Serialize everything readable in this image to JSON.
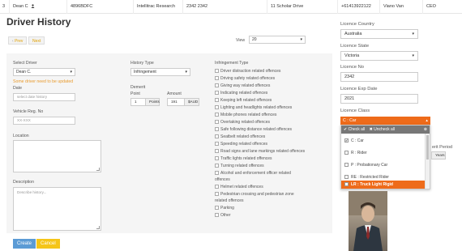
{
  "table_row": {
    "cells": [
      "3",
      "Dean C",
      "4896BDFC",
      "Intellitrac Research",
      "2342 2342",
      "11 Scholar Drive",
      "+61413922122",
      "Viano Van",
      "CEO"
    ]
  },
  "page": {
    "title": "Driver History",
    "prev_label": "Prev",
    "next_label": "Next",
    "view_label": "View",
    "view_value": "20"
  },
  "form": {
    "select_driver_label": "Select Driver",
    "select_driver_value": "Dean C.",
    "warning": "Some driver need to be updated",
    "date_label": "Date",
    "date_placeholder": "select date history",
    "vehicle_label": "Vehicle Reg. No",
    "vehicle_placeholder": "XX-XXX",
    "location_label": "Location",
    "description_label": "Description",
    "description_placeholder": "Describe history...",
    "history_type_label": "History Type",
    "history_type_value": "Infringement",
    "demerit_label": "Demerit",
    "point_label": "Point",
    "point_value": "1",
    "point_unit": "Points",
    "amount_label": "Amount",
    "amount_value": "191",
    "amount_unit": "$AUD",
    "infringement_label": "Infringement Type",
    "infringement_types": [
      "Driver distraction related offences",
      "Driving safety related offences",
      "Giving way related offences",
      "Indicating related offences",
      "Keeping left related offences",
      "Lighting and headlights related offences",
      "Mobile phones related offences",
      "Overtaking related offences",
      "Safe following distance related offences",
      "Seatbelt related offences",
      "Speeding related offences",
      "Road signs and lane markings related offences",
      "Traffic lights related offences",
      "Turning related offences",
      "Alcohol and enforcement officer related",
      "offences",
      "Helmet related offences",
      "Pedestrian crossing and pedestrian zone",
      "related offences",
      "Parking",
      "Other"
    ],
    "create_label": "Create",
    "cancel_label": "Cancel"
  },
  "licence": {
    "country_label": "Licence Country",
    "country_value": "Australia",
    "state_label": "Licence State",
    "state_value": "Victoria",
    "no_label": "Licence No",
    "no_value": "2342",
    "exp_label": "Licence Exp Date",
    "exp_value": "2021",
    "class_label": "Licence Class",
    "class_value": "C : Car",
    "check_all": "Check all",
    "uncheck_all": "Uncheck all",
    "options": [
      {
        "label": "C : Car",
        "checked": true
      },
      {
        "label": "R : Rider",
        "checked": false
      },
      {
        "label": "P : Probationary Car",
        "checked": false
      },
      {
        "label": "RE : Restricted Rider",
        "checked": false
      },
      {
        "label": "LR : Truck Light Rigid",
        "checked": false
      }
    ],
    "period_label_fragment": "erit Period",
    "period_unit": "Years"
  },
  "colors": {
    "accent": "#ee6b1a",
    "create_btn": "#5b9bd5",
    "cancel_btn": "#f5c518",
    "warning_text": "#e89a2c"
  }
}
